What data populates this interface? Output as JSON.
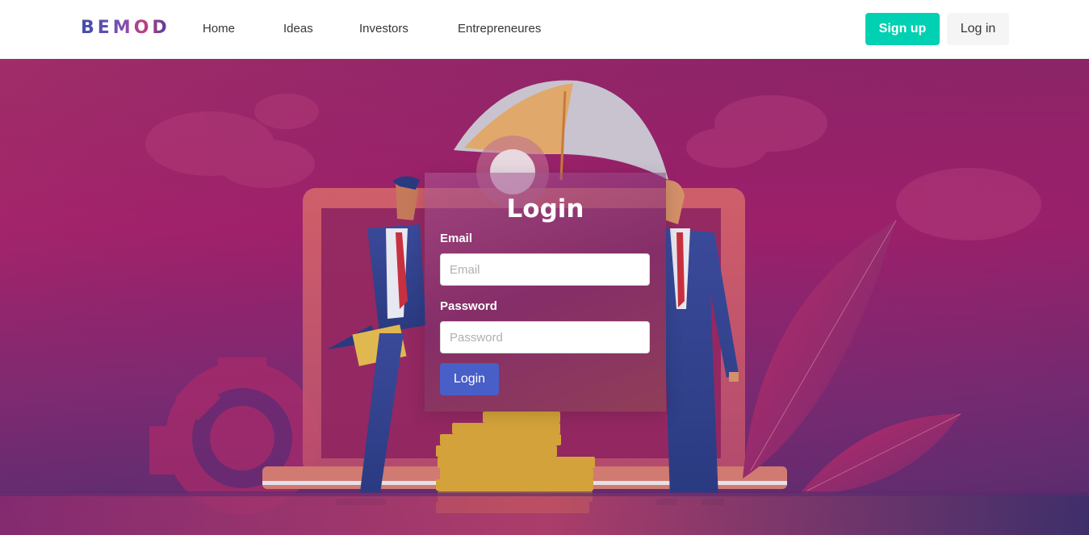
{
  "nav": {
    "brand": "BEMOD",
    "links": [
      "Home",
      "Ideas",
      "Investors",
      "Entrepreneures"
    ],
    "signup_label": "Sign up",
    "login_label": "Log in"
  },
  "login": {
    "title": "Login",
    "email_label": "Email",
    "email_placeholder": "Email",
    "password_label": "Password",
    "password_placeholder": "Password",
    "submit_label": "Login"
  },
  "colors": {
    "accent_primary": "#00d1b2",
    "button_link": "#485fc7",
    "hero_magenta": "#9d1f6a"
  }
}
